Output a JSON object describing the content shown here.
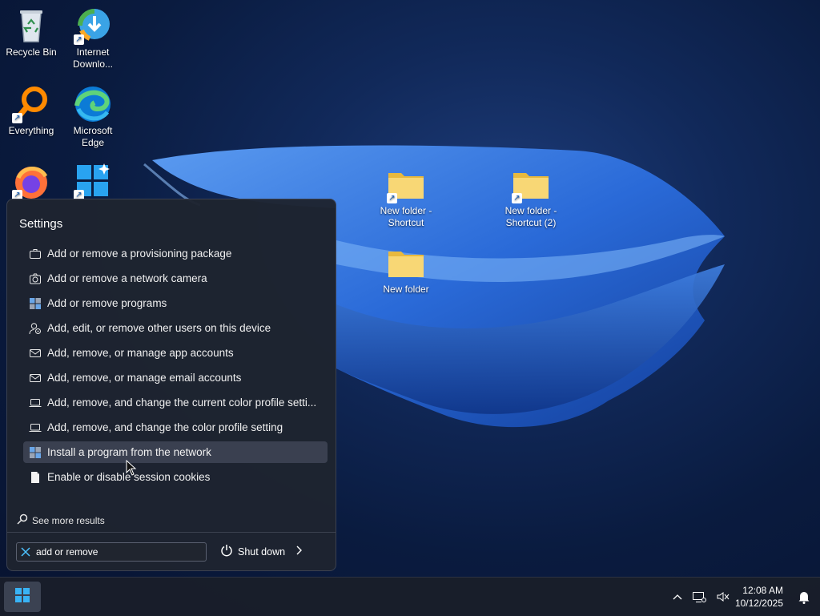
{
  "desktop": {
    "icons": [
      {
        "label": "Recycle Bin",
        "icon": "recycle-bin-icon"
      },
      {
        "label": "Internet Downlo...",
        "icon": "internet-download-manager-icon"
      },
      {
        "label": "Everything",
        "icon": "everything-search-icon"
      },
      {
        "label": "Microsoft Edge",
        "icon": "edge-icon"
      },
      {
        "label": "",
        "icon": "firefox-icon"
      },
      {
        "label": "",
        "icon": "windows-tile-icon"
      },
      {
        "label": "New folder - Shortcut",
        "icon": "folder-shortcut-icon"
      },
      {
        "label": "New folder - Shortcut (2)",
        "icon": "folder-shortcut-icon"
      },
      {
        "label": "New folder",
        "icon": "folder-icon"
      }
    ]
  },
  "search_panel": {
    "heading": "Settings",
    "results": [
      {
        "label": "Add or remove a provisioning package",
        "icon": "briefcase-icon"
      },
      {
        "label": "Add or remove a network camera",
        "icon": "camera-icon"
      },
      {
        "label": "Add or remove programs",
        "icon": "programs-icon"
      },
      {
        "label": "Add, edit, or remove other users on this device",
        "icon": "user-settings-icon"
      },
      {
        "label": "Add, remove, or manage app accounts",
        "icon": "mail-icon"
      },
      {
        "label": "Add, remove, or manage email accounts",
        "icon": "mail-icon"
      },
      {
        "label": "Add, remove, and change the current color profile setti...",
        "icon": "laptop-icon"
      },
      {
        "label": "Add, remove, and change the color profile setting",
        "icon": "laptop-icon"
      },
      {
        "label": "Install a program from the network",
        "icon": "programs-icon",
        "highlighted": true
      },
      {
        "label": "Enable or disable session cookies",
        "icon": "document-icon"
      }
    ],
    "see_more": "See more results",
    "search_value": "add or remove",
    "shutdown_label": "Shut down"
  },
  "taskbar": {
    "time": "12:08 AM",
    "date": "10/12/2025"
  },
  "colors": {
    "accent": "#4cc2ff",
    "panel_bg": "#1e2430",
    "folder": "#f8d775"
  }
}
